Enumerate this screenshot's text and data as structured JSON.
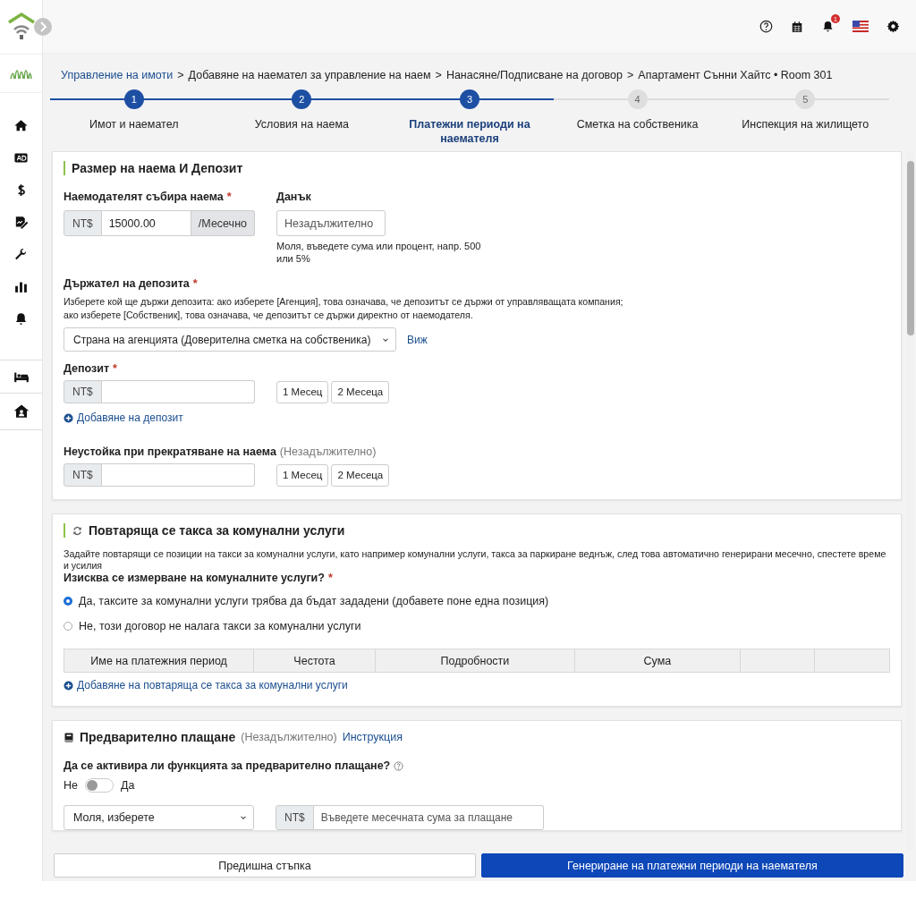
{
  "topbar": {
    "notification_badge": "1"
  },
  "breadcrumb": [
    {
      "kind": "link",
      "text": "Управление на имоти"
    },
    {
      "kind": "separator",
      "text": ">"
    },
    {
      "kind": "text",
      "text": "Добавяне на наемател за управление на наем"
    },
    {
      "kind": "separator",
      "text": ">"
    },
    {
      "kind": "text",
      "text": "Нанасяне/Подписване на договор"
    },
    {
      "kind": "separator",
      "text": ">"
    },
    {
      "kind": "text",
      "text": "Апартамент Сънни Хайтс • Room 301"
    }
  ],
  "steps": [
    {
      "number": "1",
      "label": "Имот и наемател",
      "selected": false
    },
    {
      "number": "2",
      "label": "Условия на наема",
      "selected": false
    },
    {
      "number": "3",
      "label": "Платежни периоди на наемателя",
      "selected": true
    },
    {
      "number": "4",
      "label": "Сметка на собственика",
      "selected": false
    },
    {
      "number": "5",
      "label": "Инспекция на жилището",
      "selected": false
    }
  ],
  "rent_section": {
    "title": "Размер на наема И Депозит",
    "rent": {
      "label": "Наемодателят събира наема",
      "required_mark": "*",
      "prefix": "NT$",
      "value": "15000.00",
      "suffix": "/Месечно"
    },
    "tax": {
      "label": "Данък",
      "placeholder": "Незадължително",
      "hint": "Моля, въведете сума или процент, напр. 500 или 5%"
    },
    "holder": {
      "label": "Държател на депозита",
      "required_mark": "*",
      "description": "Изберете кой ще държи депозита: ако изберете [Агенция], това означава, че депозитът се държи от управляващата компания; ако изберете [Собственик], това означава, че депозитът се държи директно от наемодателя.",
      "select": "Страна на агенцията (Доверителна сметка на собственика)",
      "link": "Виж"
    },
    "deposit": {
      "label": "Депозит",
      "required_mark": "*",
      "prefix": "NT$",
      "buttons": [
        "1 Месец",
        "2 Месеца"
      ],
      "add_link": "Добавяне на депозит"
    },
    "penalty": {
      "label": "Неустойка при прекратяване на наема",
      "optional": "(Незадължително)",
      "prefix": "NT$",
      "buttons": [
        "1 Месец",
        "2 Месеца"
      ]
    }
  },
  "utilities": {
    "title": "Повтаряща се такса за комунални услуги",
    "description": "Задайте повтарящи се позиции на такси за комунални услуги, като например комунални услуги, такса за паркиране веднъж, след това автоматично генерирани месечно, спестете време и усилия",
    "question": "Изисква се измерване на комуналните услуги?",
    "required_mark": "*",
    "options": [
      {
        "label": "Да, таксите за комунални услуги трябва да бъдат зададени (добавете поне една позиция)",
        "selected": true
      },
      {
        "label": "Не, този договор не налага такси за комунални услуги",
        "selected": false
      }
    ],
    "columns": [
      {
        "kind": "label",
        "label": "Име на платежния период"
      },
      {
        "kind": "label",
        "label": "Честота"
      },
      {
        "kind": "label",
        "label": "Подробности"
      },
      {
        "kind": "label",
        "label": "Сума"
      },
      {
        "kind": "blank"
      },
      {
        "kind": "blank"
      }
    ],
    "add_link": "Добавяне на повтаряща се такса за комунални услуги"
  },
  "prepayment": {
    "title": "Предварително плащане",
    "optional": "(Незадължително)",
    "link": "Инструкция",
    "question": "Да се активира ли функцията за предварително плащане?",
    "toggle": {
      "off_label": "Не",
      "on_label": "Да",
      "on": false
    },
    "select": "Моля, изберете",
    "amount": {
      "prefix": "NT$",
      "placeholder": "Въведете месечната сума за плащане"
    }
  },
  "footer": {
    "back": "Предишна стъпка",
    "next": "Генериране на платежни периоди на наемателя"
  }
}
